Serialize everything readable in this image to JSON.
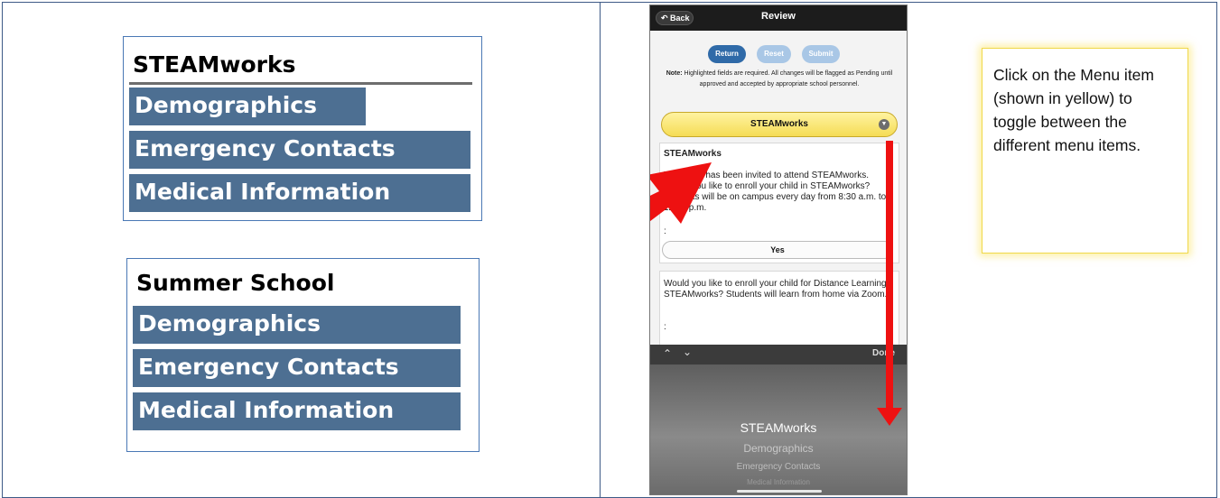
{
  "menus": [
    {
      "title": "STEAMworks",
      "items": [
        "Demographics",
        "Emergency Contacts",
        "Medical Information"
      ]
    },
    {
      "title": "Summer School",
      "items": [
        "Demographics",
        "Emergency Contacts",
        "Medical Information"
      ]
    }
  ],
  "phone": {
    "back_label": "Back",
    "nav_title": "Review",
    "buttons": {
      "return": "Return",
      "reset": "Reset",
      "submit": "Submit"
    },
    "note_label": "Note:",
    "note_text": " Highlighted fields are required. All changes will be flagged as Pending until approved and accepted by appropriate school personnel.",
    "selected_menu": "STEAMworks",
    "section_title": "STEAMworks",
    "question_1": "Your child has been invited to attend STEAMworks. Would you like to enroll your child in STEAMworks? Students will be on campus every day from 8:30 a.m. to 12:00 p.m.",
    "colon_1": ":",
    "answer_1": "Yes",
    "question_2": "Would you like to enroll your child for Distance Learning STEAMworks? Students will learn from home via Zoom.",
    "colon_2": ":",
    "done_label": "Done",
    "picker_options": [
      "STEAMworks",
      "Demographics",
      "Emergency Contacts",
      "Medical Information"
    ]
  },
  "callout": {
    "text": "Click on the Menu item (shown in yellow) to toggle between the different menu items."
  },
  "colors": {
    "menu_item_bg": "#4d6f92",
    "frame_border": "#3d5a86",
    "selected_menu_bg": "#f5dc55",
    "arrow": "#ee1111",
    "button_active": "#2f6aa8",
    "button_disabled": "#a9c7e6"
  }
}
